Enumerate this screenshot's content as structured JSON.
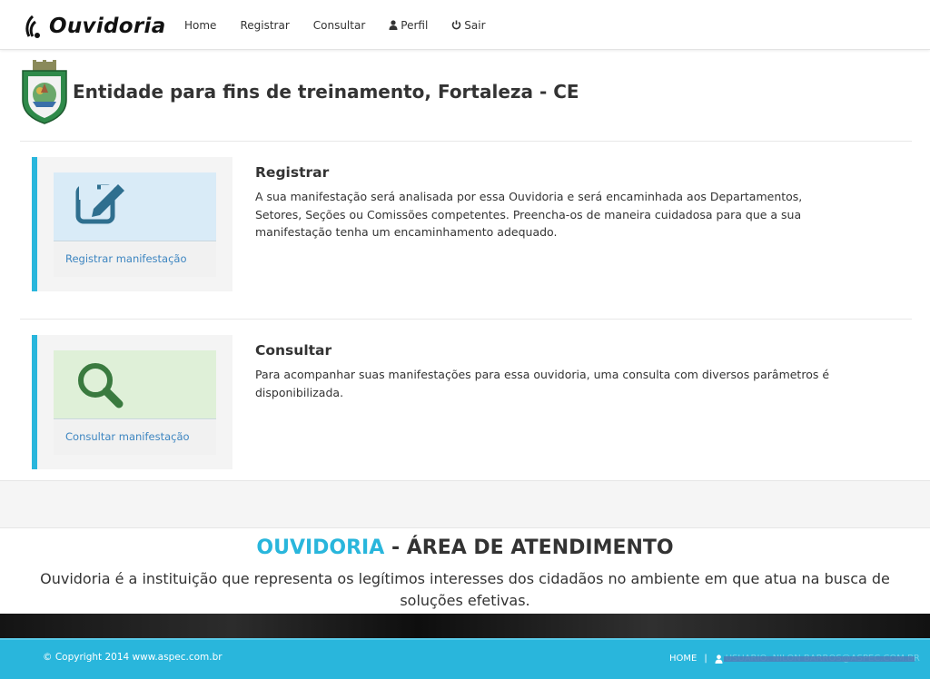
{
  "brand": {
    "name": "Ouvidoria",
    "accent_color": "#29b6dc"
  },
  "nav": {
    "items": [
      {
        "label": "Home",
        "icon": ""
      },
      {
        "label": "Registrar",
        "icon": ""
      },
      {
        "label": "Consultar",
        "icon": ""
      },
      {
        "label": "Perfil",
        "icon": "user-icon"
      },
      {
        "label": "Sair",
        "icon": "power-icon"
      }
    ]
  },
  "header": {
    "title": "Entidade para fins de treinamento, Fortaleza - CE"
  },
  "sections": [
    {
      "title": "Registrar",
      "text": "A sua manifestação será analisada por essa Ouvidoria e será encaminhada aos Departamentos, Setores, Seções ou Comissões competentes. Preencha-os de maneira cuidadosa para que a sua manifestação tenha um encaminhamento adequado.",
      "link": "Registrar manifestação",
      "icon": "edit-icon",
      "box_color": "#d9ebf7",
      "icon_color": "#2f6f8f"
    },
    {
      "title": "Consultar",
      "text": "Para acompanhar suas manifestações para essa ouvidoria, uma consulta com diversos parâmetros é disponibilizada.",
      "link": "Consultar manifestação",
      "icon": "search-icon",
      "box_color": "#dff0d8",
      "icon_color": "#3a7a3f"
    }
  ],
  "about": {
    "title_accent": "OUVIDORIA",
    "title_rest": " - ÁREA DE ATENDIMENTO",
    "text": "Ouvidoria é a instituição que representa os legítimos interesses dos cidadãos no ambiente em que atua na busca de soluções efetivas."
  },
  "footer": {
    "copyright": "© Copyright 2014 www.aspec.com.br",
    "home": "HOME",
    "separator": "|",
    "user": "USUARIO: NILON BARROS@ASPEC.COM.BR"
  }
}
